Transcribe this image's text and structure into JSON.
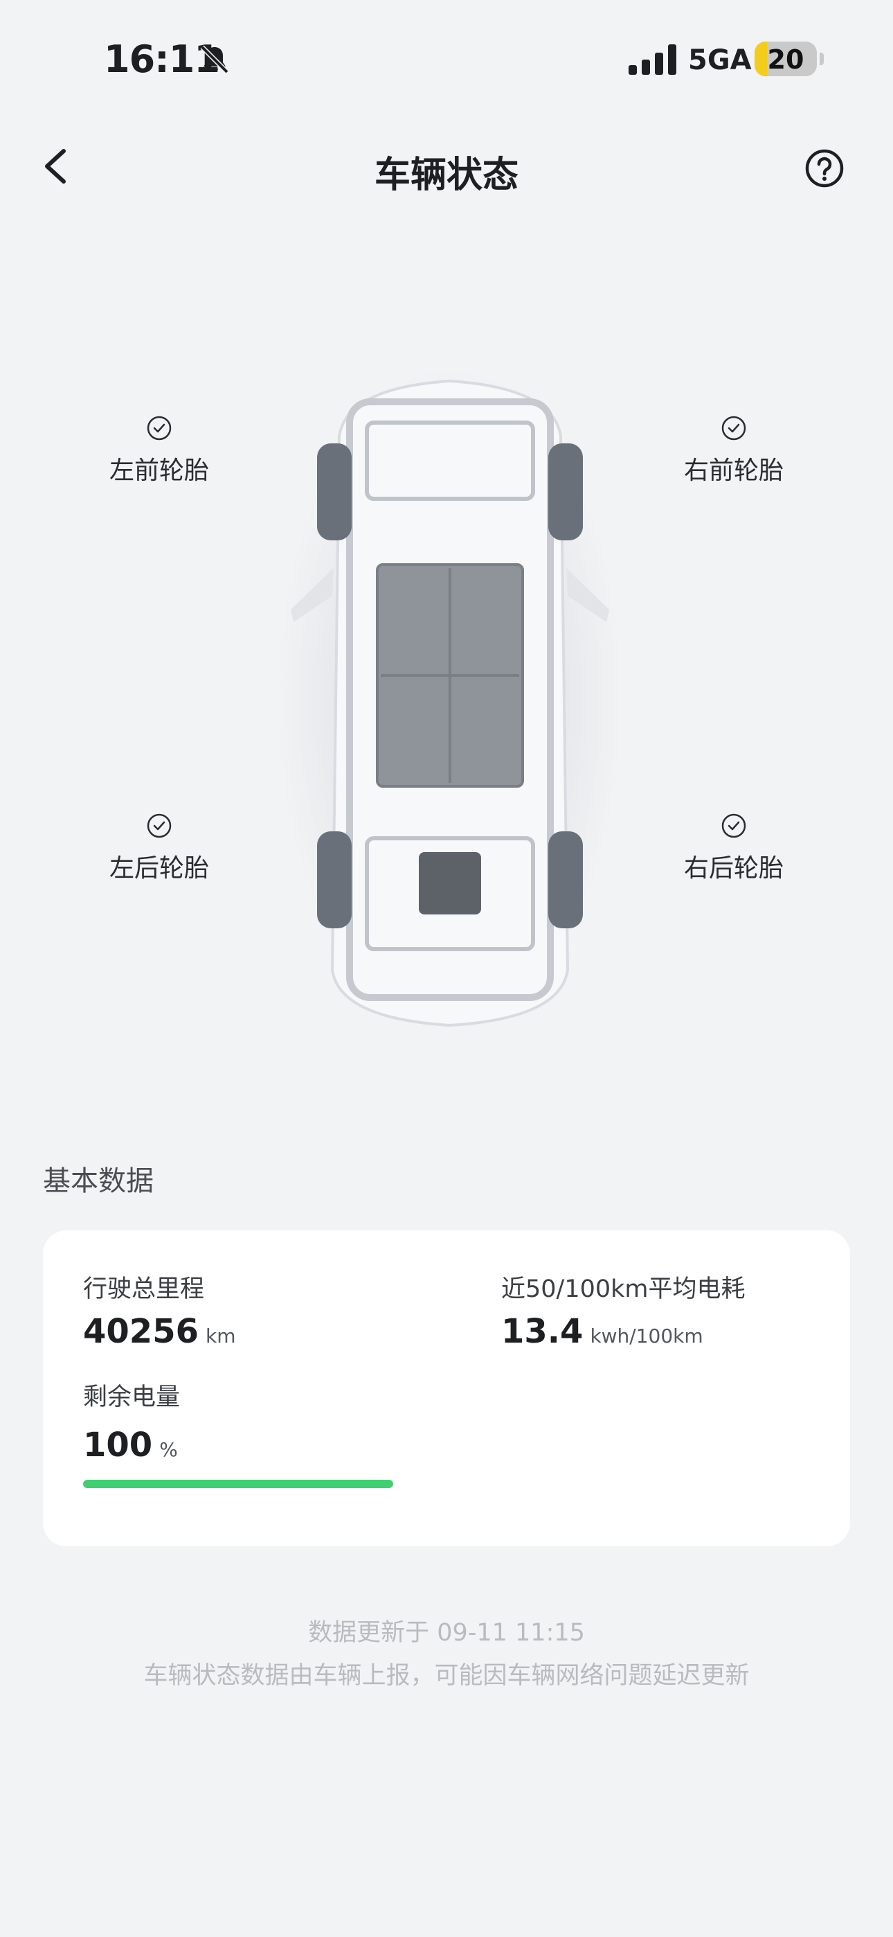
{
  "status_bar": {
    "time": "16:11",
    "network": "5GA",
    "battery_level": "20",
    "battery_fraction": 0.2
  },
  "header": {
    "title": "车辆状态"
  },
  "tires": {
    "front_left": "左前轮胎",
    "front_right": "右前轮胎",
    "rear_left": "左后轮胎",
    "rear_right": "右后轮胎"
  },
  "basic_data": {
    "title": "基本数据",
    "mileage_label": "行驶总里程",
    "mileage_value": "40256",
    "mileage_unit": "km",
    "consumption_label": "近50/100km平均电耗",
    "consumption_value": "13.4",
    "consumption_unit": "kwh/100km",
    "battery_label": "剩余电量",
    "battery_value": "100",
    "battery_unit": "%",
    "battery_percent": 100
  },
  "footer": {
    "updated": "数据更新于 09-11 11:15",
    "note": "车辆状态数据由车辆上报，可能因车辆网络问题延迟更新"
  },
  "colors": {
    "background": "#f2f3f4",
    "card": "#ffffff",
    "progress": "#3fd06f",
    "battery_status": "#f4cc1b"
  },
  "icons": [
    "bell-muted-icon",
    "signal-icon",
    "battery-icon",
    "back-arrow-icon",
    "help-icon",
    "check-circle-icon"
  ]
}
